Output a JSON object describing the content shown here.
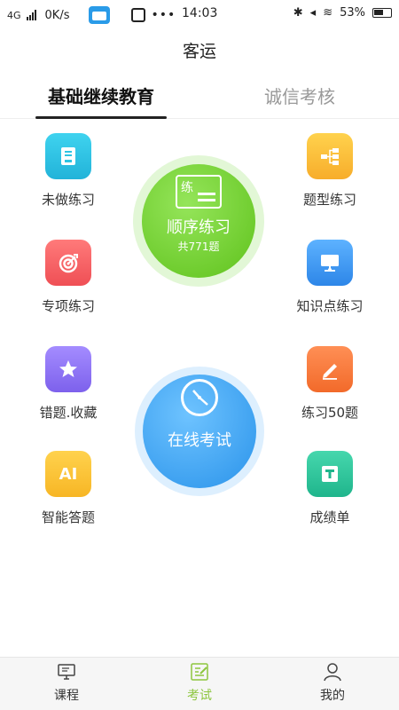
{
  "status_bar": {
    "network": "4G",
    "speed": "0K/s",
    "dots": "•••",
    "time": "14:03",
    "battery": "53%"
  },
  "header": {
    "title": "客运"
  },
  "tabs": [
    {
      "label": "基础继续教育",
      "active": true
    },
    {
      "label": "诚信考核",
      "active": false
    }
  ],
  "left_items": [
    {
      "label": "未做练习",
      "icon": "document-icon",
      "color": "#2ec4e3"
    },
    {
      "label": "专项练习",
      "icon": "target-icon",
      "color": "#f46266"
    },
    {
      "label": "错题.收藏",
      "icon": "star-icon",
      "color": "#8f75f5"
    },
    {
      "label": "智能答题",
      "icon": "ai-icon",
      "icon_text": "AI",
      "color": "#fbc43b"
    }
  ],
  "right_items": [
    {
      "label": "题型练习",
      "icon": "flowchart-icon",
      "color": "#fbc43b"
    },
    {
      "label": "知识点练习",
      "icon": "presentation-icon",
      "color": "#449ef5"
    },
    {
      "label": "练习50题",
      "icon": "pencil-icon",
      "color": "#f77b3e"
    },
    {
      "label": "成绩单",
      "icon": "scorecard-icon",
      "color": "#2fc69c"
    }
  ],
  "sequential_practice": {
    "board_char": "练",
    "title": "顺序练习",
    "subtitle": "共771题",
    "color": "#6fcf2a"
  },
  "online_exam": {
    "title": "在线考试",
    "color": "#3a9cf0"
  },
  "bottom_nav": [
    {
      "label": "课程",
      "icon": "monitor-icon",
      "active": false
    },
    {
      "label": "考试",
      "icon": "exam-icon",
      "active": true
    },
    {
      "label": "我的",
      "icon": "person-icon",
      "active": false
    }
  ],
  "colors": {
    "accent_green": "#8dc63f"
  }
}
